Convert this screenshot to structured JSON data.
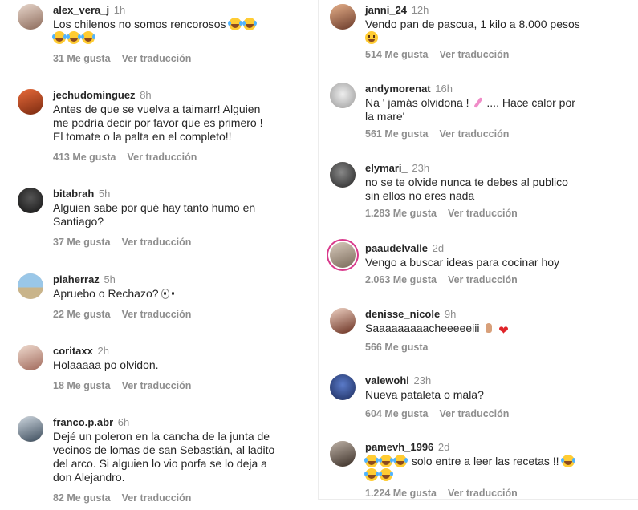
{
  "left_comments": [
    {
      "user": "alex_vera_j",
      "time": "1h",
      "text": "Los chilenos no somos rencorosos",
      "likes": "31 Me gusta",
      "translate": "Ver traducción"
    },
    {
      "user": "jechudominguez",
      "time": "8h",
      "text_lines": [
        "Antes de que se vuelva a taimarr! Alguien",
        "me podría decir por favor que es primero !",
        "El tomate o la palta en el completo!!"
      ],
      "likes": "413 Me gusta",
      "translate": "Ver traducción"
    },
    {
      "user": "bitabrah",
      "time": "5h",
      "text_lines": [
        "Alguien sabe por qué hay tanto humo en",
        "Santiago?"
      ],
      "likes": "37 Me gusta",
      "translate": "Ver traducción"
    },
    {
      "user": "piaherraz",
      "time": "5h",
      "text": "Apruebo o Rechazo?",
      "likes": "22 Me gusta",
      "translate": "Ver traducción"
    },
    {
      "user": "coritaxx",
      "time": "2h",
      "text": "Holaaaaa po olvidon.",
      "likes": "18 Me gusta",
      "translate": "Ver traducción"
    },
    {
      "user": "franco.p.abr",
      "time": "6h",
      "text_lines": [
        "Dejé un poleron en la cancha de la junta de",
        "vecinos de lomas de san Sebastián, al ladito",
        "del arco. Si alguien lo vio porfa se lo deja a",
        "don Alejandro."
      ],
      "likes": "82 Me gusta",
      "translate": "Ver traducción"
    }
  ],
  "right_comments": [
    {
      "user": "janni_24",
      "time": "12h",
      "text": "Vendo pan de pascua, 1 kilo a 8.000 pesos",
      "likes": "514 Me gusta",
      "translate": "Ver traducción"
    },
    {
      "user": "andymorenat",
      "time": "16h",
      "text_a": "Na ' jamás olvidona !",
      "text_b": ".... Hace calor por",
      "text_c": "la mare'",
      "likes": "561 Me gusta",
      "translate": "Ver traducción"
    },
    {
      "user": "elymari_",
      "time": "23h",
      "text_lines": [
        "no se te olvide nunca te debes al publico",
        "sin ellos no eres nada"
      ],
      "likes": "1.283 Me gusta",
      "translate": "Ver traducción"
    },
    {
      "user": "paaudelvalle",
      "time": "2d",
      "text": "Vengo a buscar ideas para cocinar hoy",
      "likes": "2.063 Me gusta",
      "translate": "Ver traducción"
    },
    {
      "user": "denisse_nicole",
      "time": "9h",
      "text": "Saaaaaaaaacheeeeeiii",
      "likes": "566 Me gusta"
    },
    {
      "user": "valewohl",
      "time": "23h",
      "text": "Nueva pataleta o mala?",
      "likes": "604 Me gusta",
      "translate": "Ver traducción"
    },
    {
      "user": "pamevh_1996",
      "time": "2d",
      "text": "solo entre a leer las recetas !!",
      "likes": "1.224 Me gusta",
      "translate": "Ver traducción"
    }
  ],
  "icons": {
    "laugh": "face-with-tears-of-joy-emoji",
    "wink": "winking-face-emoji",
    "eyes": "eyes-emoji",
    "brush": "nail-polish-emoji",
    "hand": "open-hand-emoji",
    "heart": "red-heart-emoji"
  },
  "colors": {
    "username": "#262626",
    "muted": "#8e8e8e",
    "story_ring": "#d93a8c",
    "heart": "#e0242a"
  }
}
